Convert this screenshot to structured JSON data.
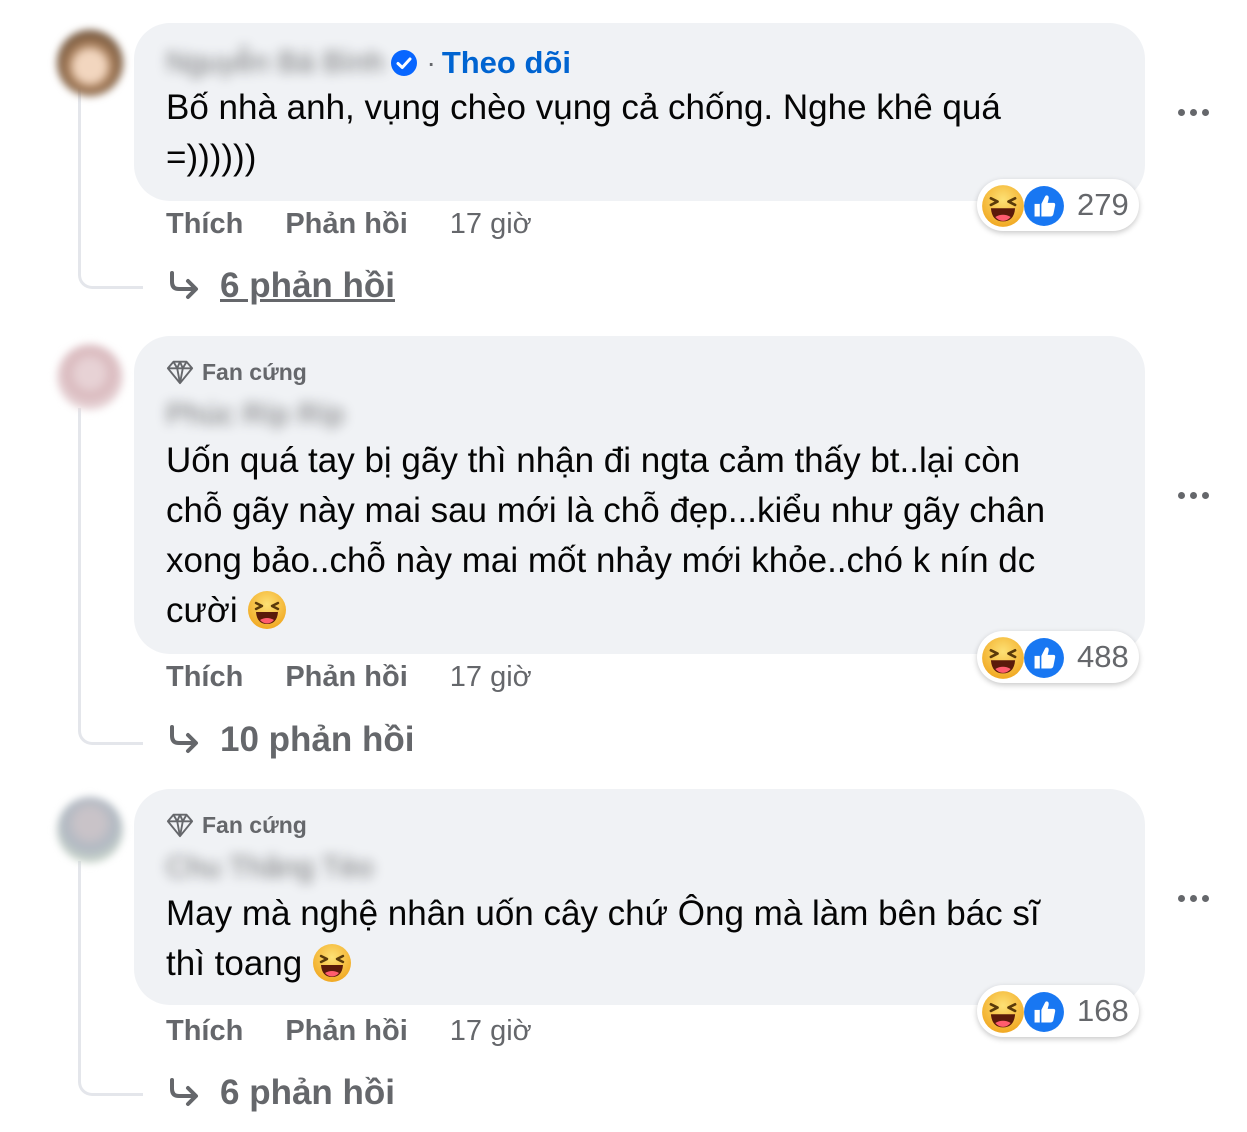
{
  "comments": [
    {
      "author_name": "Nguyễn Bá Bình",
      "follow_label": "Theo dõi",
      "separator": "·",
      "text": "Bố nhà anh, vụng chèo vụng cả chống. Nghe khê quá\n=))))))",
      "reaction_count": "279",
      "like_label": "Thích",
      "reply_label": "Phản hồi",
      "time": "17 giờ",
      "replies_label": "6 phản hồi"
    },
    {
      "badge": "Fan cứng",
      "author_name": "Phúc Ríp Ríp",
      "text": "Uốn quá tay bị gãy thì nhận đi ngta cảm thấy bt..lại còn\nchỗ gãy này mai sau mới là chỗ đẹp...kiểu như gãy chân\nxong bảo..chỗ này mai mốt nhảy mới khỏe..chó k nín dc\ncười ",
      "reaction_count": "488",
      "like_label": "Thích",
      "reply_label": "Phản hồi",
      "time": "17 giờ",
      "replies_label": "10 phản hồi"
    },
    {
      "badge": "Fan cứng",
      "author_name": "Chu Thăng Tèo",
      "text": "May mà nghệ nhân uốn cây chứ Ông mà làm bên bác sĩ\nthì toang ",
      "reaction_count": "168",
      "like_label": "Thích",
      "reply_label": "Phản hồi",
      "time": "17 giờ",
      "replies_label": "6 phản hồi"
    }
  ],
  "icons": {
    "verified": "verified-badge-icon",
    "badge": "diamond-icon",
    "reply_arrow": "reply-arrow-icon",
    "more": "more-options-icon",
    "haha": "haha-reaction-icon",
    "like": "like-reaction-icon"
  },
  "colors": {
    "bubble": "#f0f2f5",
    "link_blue": "#0064d1",
    "secondary_text": "#65676b",
    "like_blue": "#1877f2",
    "haha_yellow": "#f7b928"
  }
}
